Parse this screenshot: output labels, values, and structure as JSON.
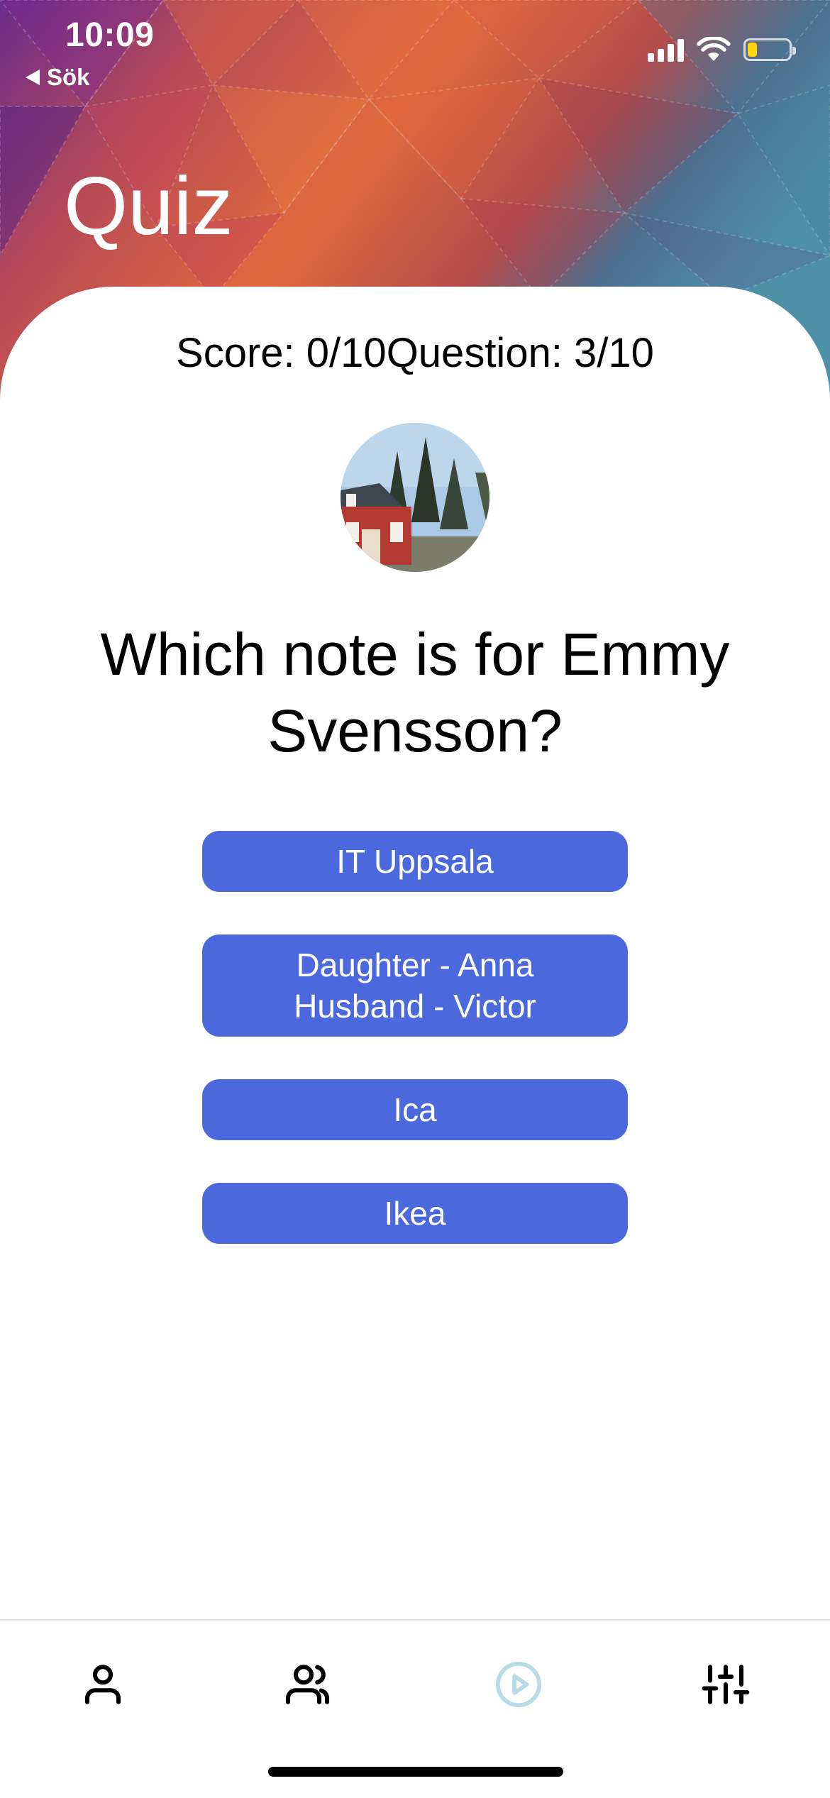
{
  "status_bar": {
    "time": "10:09",
    "back_label": "Sök",
    "battery_color": "#ffd60a"
  },
  "header": {
    "title": "Quiz"
  },
  "quiz": {
    "score_text": "Score: 0/10",
    "question_counter_text": "Question: 3/10",
    "question": "Which note is for Emmy Svensson?",
    "avatar_icon": "house-photo",
    "answers": [
      {
        "label": "IT Uppsala"
      },
      {
        "label": "Daughter - Anna\nHusband - Victor"
      },
      {
        "label": "Ica"
      },
      {
        "label": "Ikea"
      }
    ],
    "button_color": "#4c68dd"
  },
  "tabbar": {
    "tabs": [
      {
        "icon": "person-icon"
      },
      {
        "icon": "people-icon"
      },
      {
        "icon": "play-circle-icon",
        "active": true
      },
      {
        "icon": "sliders-icon"
      }
    ],
    "active_color": "#b9dbe6"
  }
}
